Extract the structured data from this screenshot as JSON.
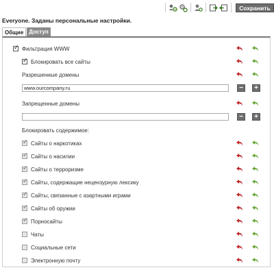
{
  "toolbar": {
    "save_label": "Сохранить"
  },
  "title": "Everyone. Заданы персональные настройки.",
  "tabs": [
    {
      "label": "Общие",
      "active": true
    },
    {
      "label": "Доступ",
      "active": false
    }
  ],
  "filter": {
    "www_filter": {
      "label": "Фильтрация WWW",
      "checked": true
    },
    "block_all": {
      "label": "Блокировать все сайты",
      "checked": true
    },
    "allowed_domains_label": "Разрешенные домены",
    "allowed_domains_value": "www.ourcompany.ru",
    "forbidden_domains_label": "Запрещенные домены",
    "forbidden_domains_value": "",
    "block_content_label": "Блокировать содержимое:",
    "categories": [
      {
        "label": "Сайты о наркотиках",
        "checked": true
      },
      {
        "label": "Сайты о насилии",
        "checked": true
      },
      {
        "label": "Сайты о терроризме",
        "checked": true
      },
      {
        "label": "Сайты, содержащие нецензурную лексику",
        "checked": true
      },
      {
        "label": "Сайты, связанные с азартными играми",
        "checked": true
      },
      {
        "label": "Сайты об оружии",
        "checked": true
      },
      {
        "label": "Порносайты",
        "checked": true
      },
      {
        "label": "Чаты",
        "checked": false
      },
      {
        "label": "Социальные сети",
        "checked": false
      },
      {
        "label": "Электронную почту",
        "checked": false
      }
    ]
  },
  "icons": {
    "undo": "undo-arrow-icon",
    "apply": "apply-arrow-icon",
    "minus": "−",
    "plus": "+"
  },
  "colors": {
    "undo_arrow": "#c0282a",
    "apply_arrow": "#6aa83a",
    "save_button": "#6d6d6d",
    "active_tab_border": "#777777"
  }
}
